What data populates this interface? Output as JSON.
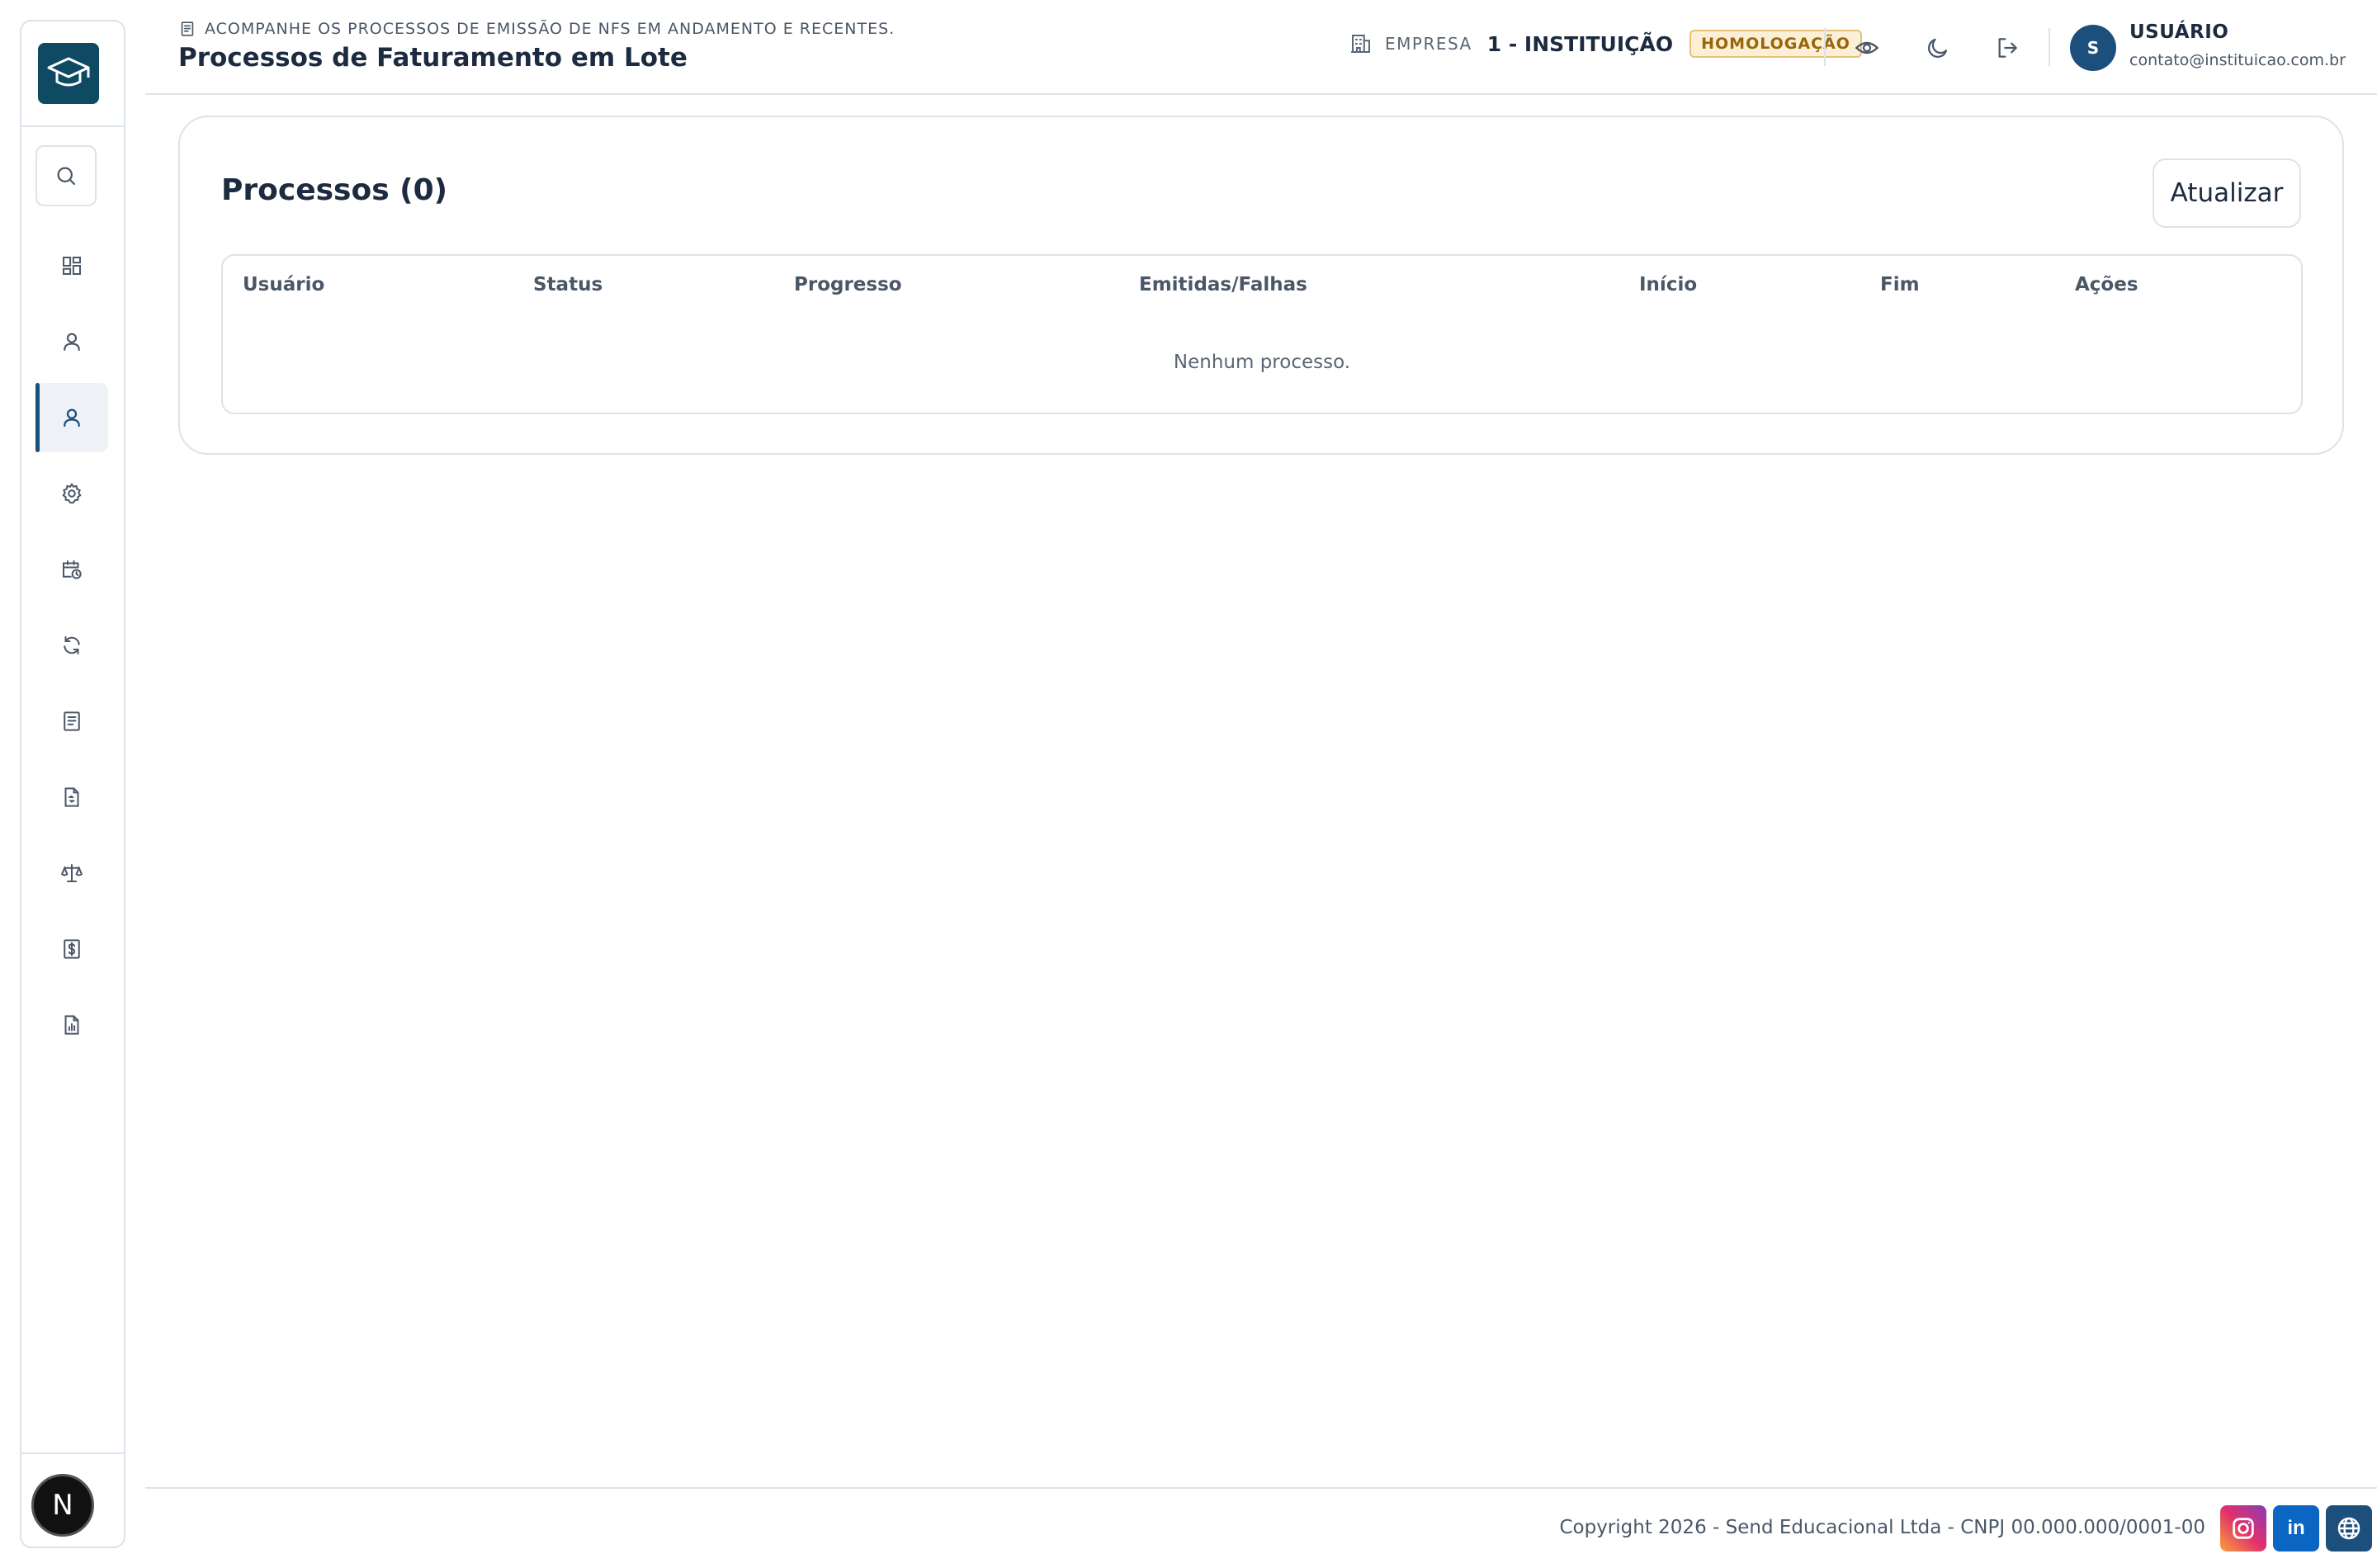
{
  "header": {
    "subtitle": "ACOMPANHE OS PROCESSOS DE EMISSÃO DE NFS EM ANDAMENTO E RECENTES.",
    "title": "Processos de Faturamento em Lote",
    "company_label": "EMPRESA",
    "company_name": "1 - INSTITUIÇÃO",
    "environment_badge": "HOMOLOGAÇÃO",
    "user_initial": "S",
    "user_name": "USUÁRIO",
    "user_email": "contato@instituicao.com.br",
    "icons": [
      "document-icon",
      "building-icon",
      "eye-icon",
      "moon-icon",
      "logout-icon"
    ]
  },
  "sidebar": {
    "logo_icon": "graduation-cap-icon",
    "search_icon": "search-icon",
    "items": [
      {
        "icon": "dashboard-icon",
        "active": false
      },
      {
        "icon": "user-icon",
        "active": false
      },
      {
        "icon": "user-icon",
        "active": true
      },
      {
        "icon": "gear-icon",
        "active": false
      },
      {
        "icon": "calendar-clock-icon",
        "active": false
      },
      {
        "icon": "refresh-icon",
        "active": false
      },
      {
        "icon": "document-icon",
        "active": false
      },
      {
        "icon": "file-transfer-icon",
        "active": false
      },
      {
        "icon": "scale-icon",
        "active": false
      },
      {
        "icon": "receipt-dollar-icon",
        "active": false
      },
      {
        "icon": "report-chart-icon",
        "active": false
      }
    ],
    "bottom_badge": "N"
  },
  "main": {
    "card_title": "Processos (0)",
    "refresh_label": "Atualizar",
    "table": {
      "columns": [
        "Usuário",
        "Status",
        "Progresso",
        "Emitidas/Falhas",
        "Início",
        "Fim",
        "Ações"
      ],
      "rows": [],
      "empty_message": "Nenhum processo."
    }
  },
  "footer": {
    "copyright": "Copyright 2026 - Send Educacional Ltda - CNPJ 00.000.000/0001-00",
    "social": [
      {
        "name": "instagram-icon",
        "color": "#d6249f"
      },
      {
        "name": "linkedin-icon",
        "label": "in",
        "color": "#0a66c2"
      },
      {
        "name": "globe-icon",
        "color": "#1d4f7c"
      }
    ]
  },
  "colors": {
    "brand": "#0f4a63",
    "accent": "#1d4f7c",
    "border": "#dde3ea",
    "badge_bg": "#fbf0d6",
    "badge_text": "#9a6408"
  }
}
